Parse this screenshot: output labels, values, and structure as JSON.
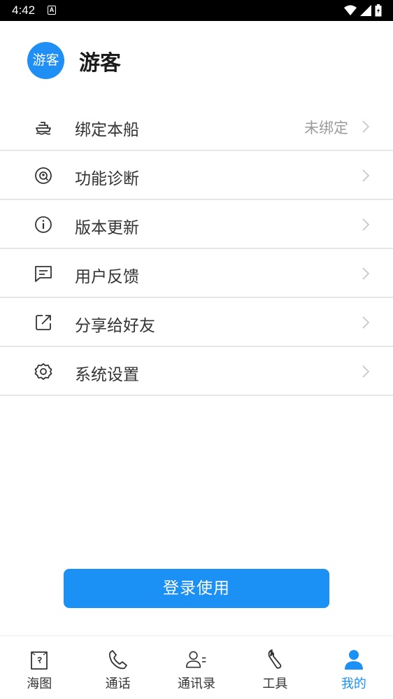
{
  "status_bar": {
    "time": "4:42",
    "notification_badge": "A"
  },
  "profile": {
    "avatar_text": "游客",
    "username": "游客"
  },
  "menu": {
    "items": [
      {
        "label": "绑定本船",
        "value": "未绑定",
        "icon": "ship-icon"
      },
      {
        "label": "功能诊断",
        "value": "",
        "icon": "diagnosis-icon"
      },
      {
        "label": "版本更新",
        "value": "",
        "icon": "info-icon"
      },
      {
        "label": "用户反馈",
        "value": "",
        "icon": "feedback-icon"
      },
      {
        "label": "分享给好友",
        "value": "",
        "icon": "share-icon"
      },
      {
        "label": "系统设置",
        "value": "",
        "icon": "gear-icon"
      }
    ]
  },
  "login_button": {
    "label": "登录使用"
  },
  "tabbar": {
    "tabs": [
      {
        "label": "海图",
        "icon": "map-icon",
        "active": false
      },
      {
        "label": "通话",
        "icon": "phone-icon",
        "active": false
      },
      {
        "label": "通讯录",
        "icon": "contacts-icon",
        "active": false
      },
      {
        "label": "工具",
        "icon": "wrench-icon",
        "active": false
      },
      {
        "label": "我的",
        "icon": "person-icon",
        "active": true
      }
    ]
  },
  "colors": {
    "accent": "#1b90f5",
    "divider": "#e6e6e6",
    "text": "#333333",
    "muted": "#9a9a9a"
  }
}
